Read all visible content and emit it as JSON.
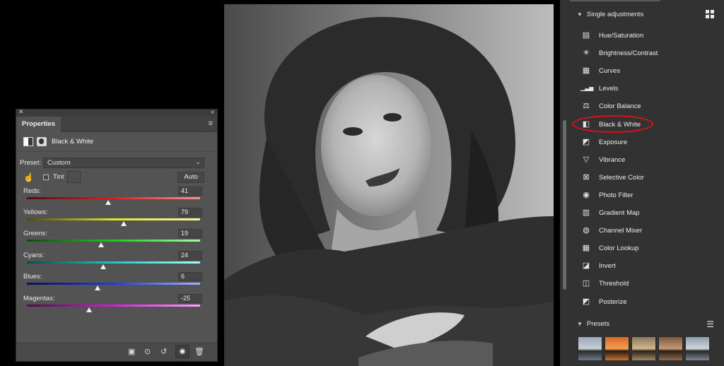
{
  "properties": {
    "tab": "Properties",
    "layer_title": "Black & White",
    "preset_label": "Preset:",
    "preset_value": "Custom",
    "tint_label": "Tint",
    "auto_label": "Auto",
    "sliders": [
      {
        "label": "Reds:",
        "value": "41",
        "level": 0.47
      },
      {
        "label": "Yellows:",
        "value": "79",
        "level": 0.56
      },
      {
        "label": "Greens:",
        "value": "19",
        "level": 0.43
      },
      {
        "label": "Cyans:",
        "value": "24",
        "level": 0.44
      },
      {
        "label": "Blues:",
        "value": "6",
        "level": 0.41
      },
      {
        "label": "Magentas:",
        "value": "-25",
        "level": 0.36
      }
    ]
  },
  "adjustments": {
    "header": "Single adjustments",
    "items": [
      {
        "label": "Hue/Saturation",
        "icon": "hue-saturation-icon"
      },
      {
        "label": "Brightness/Contrast",
        "icon": "brightness-contrast-icon"
      },
      {
        "label": "Curves",
        "icon": "curves-icon"
      },
      {
        "label": "Levels",
        "icon": "levels-icon"
      },
      {
        "label": "Color Balance",
        "icon": "color-balance-icon"
      },
      {
        "label": "Black & White",
        "icon": "black-white-icon"
      },
      {
        "label": "Exposure",
        "icon": "exposure-icon"
      },
      {
        "label": "Vibrance",
        "icon": "vibrance-icon"
      },
      {
        "label": "Selective Color",
        "icon": "selective-color-icon"
      },
      {
        "label": "Photo Filter",
        "icon": "photo-filter-icon"
      },
      {
        "label": "Gradient Map",
        "icon": "gradient-map-icon"
      },
      {
        "label": "Channel Mixer",
        "icon": "channel-mixer-icon"
      },
      {
        "label": "Color Lookup",
        "icon": "color-lookup-icon"
      },
      {
        "label": "Invert",
        "icon": "invert-icon"
      },
      {
        "label": "Threshold",
        "icon": "threshold-icon"
      },
      {
        "label": "Posterize",
        "icon": "posterize-icon"
      }
    ],
    "presets_header": "Presets"
  },
  "colors": {
    "highlight": "#e0101b",
    "panel_bg": "#535353",
    "adj_bg": "#323232"
  }
}
